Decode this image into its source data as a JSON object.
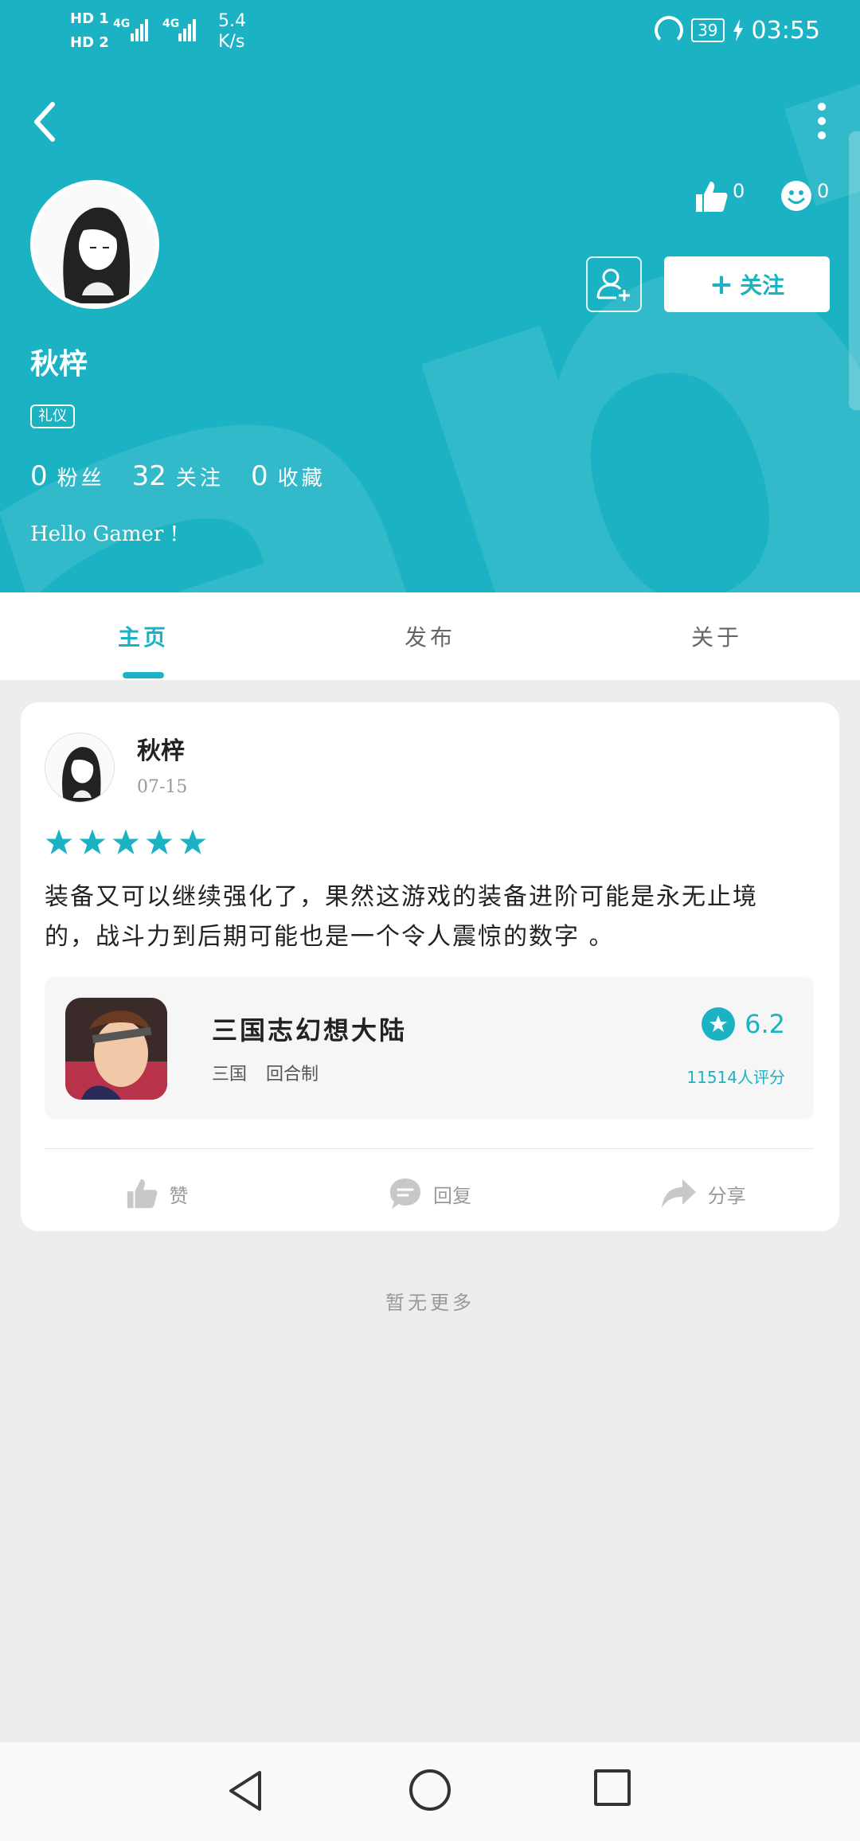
{
  "status_bar": {
    "sim1": "HD 1",
    "sim2": "HD 2",
    "network1": "4G",
    "network2": "4G",
    "speed_value": "5.4",
    "speed_unit": "K/s",
    "battery": "39",
    "time": "03:55"
  },
  "header": {
    "watermark": "apTa",
    "likes_count": "0",
    "faces_count": "0",
    "follow_label": "关注",
    "follow_plus": "+",
    "colors": {
      "accent": "#1bb3c4",
      "background": "#ededed"
    }
  },
  "profile": {
    "name": "秋梓",
    "tag": "礼仪",
    "stats": [
      {
        "num": "0",
        "label": "粉丝"
      },
      {
        "num": "32",
        "label": "关注"
      },
      {
        "num": "0",
        "label": "收藏"
      }
    ],
    "bio": "Hello Gamer !"
  },
  "tabs": [
    {
      "label": "主页",
      "active": true
    },
    {
      "label": "发布",
      "active": false
    },
    {
      "label": "关于",
      "active": false
    }
  ],
  "post": {
    "author": "秋梓",
    "date": "07-15",
    "rating_stars": 5,
    "text_line1": "装备又可以继续强化了，果然这游戏的装备进阶可能是永无止境",
    "text_line2": "的，战斗力到后期可能也是一个令人震惊的数字 。",
    "game": {
      "title": "三国志幻想大陆",
      "tags": [
        "三国",
        "回合制"
      ],
      "rating": "6.2",
      "reviews": "11514人评分"
    },
    "actions": {
      "like": "赞",
      "reply": "回复",
      "share": "分享"
    }
  },
  "footer": {
    "no_more": "暂无更多"
  }
}
